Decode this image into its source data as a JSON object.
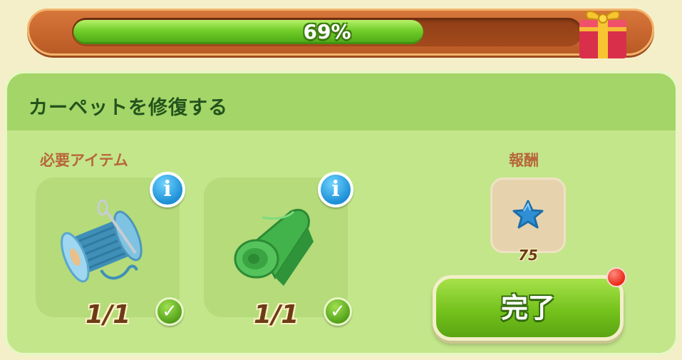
{
  "progress": {
    "percent_label": "69%",
    "value": 0.69
  },
  "task": {
    "title": "カーペットを修復する",
    "required_label": "必要アイテム",
    "reward_label": "報酬",
    "items": [
      {
        "icon": "thread-spool-icon",
        "count": "1/1",
        "complete": true
      },
      {
        "icon": "green-fabric-roll-icon",
        "count": "1/1",
        "complete": true
      }
    ],
    "reward": {
      "icon": "blue-star-icon",
      "amount": "75"
    },
    "complete_button": "完了"
  },
  "colors": {
    "progress_fill": "#71cc28",
    "header_bar": "#c0662f",
    "panel": "#c3e68b",
    "info_badge": "#1d8fd6",
    "notification": "#e8291a"
  }
}
